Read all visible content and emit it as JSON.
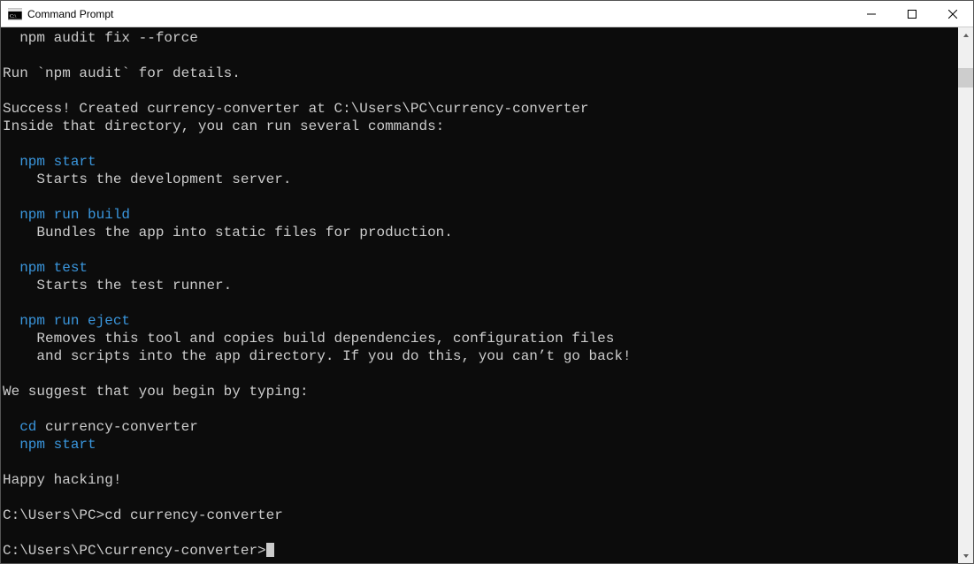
{
  "window": {
    "title": "Command Prompt"
  },
  "terminal": {
    "lines": [
      {
        "indent": 2,
        "segments": [
          {
            "style": "white",
            "text": "npm audit fix --force"
          }
        ]
      },
      {
        "blank": true
      },
      {
        "indent": 0,
        "segments": [
          {
            "style": "white",
            "text": "Run `npm audit` for details."
          }
        ]
      },
      {
        "blank": true
      },
      {
        "indent": 0,
        "segments": [
          {
            "style": "white",
            "text": "Success! Created currency-converter at C:\\Users\\PC\\currency-converter"
          }
        ]
      },
      {
        "indent": 0,
        "segments": [
          {
            "style": "white",
            "text": "Inside that directory, you can run several commands:"
          }
        ]
      },
      {
        "blank": true
      },
      {
        "indent": 2,
        "segments": [
          {
            "style": "cyan",
            "text": "npm start"
          }
        ]
      },
      {
        "indent": 4,
        "segments": [
          {
            "style": "white",
            "text": "Starts the development server."
          }
        ]
      },
      {
        "blank": true
      },
      {
        "indent": 2,
        "segments": [
          {
            "style": "cyan",
            "text": "npm run build"
          }
        ]
      },
      {
        "indent": 4,
        "segments": [
          {
            "style": "white",
            "text": "Bundles the app into static files for production."
          }
        ]
      },
      {
        "blank": true
      },
      {
        "indent": 2,
        "segments": [
          {
            "style": "cyan",
            "text": "npm test"
          }
        ]
      },
      {
        "indent": 4,
        "segments": [
          {
            "style": "white",
            "text": "Starts the test runner."
          }
        ]
      },
      {
        "blank": true
      },
      {
        "indent": 2,
        "segments": [
          {
            "style": "cyan",
            "text": "npm run eject"
          }
        ]
      },
      {
        "indent": 4,
        "segments": [
          {
            "style": "white",
            "text": "Removes this tool and copies build dependencies, configuration files"
          }
        ]
      },
      {
        "indent": 4,
        "segments": [
          {
            "style": "white",
            "text": "and scripts into the app directory. If you do this, you can’t go back!"
          }
        ]
      },
      {
        "blank": true
      },
      {
        "indent": 0,
        "segments": [
          {
            "style": "white",
            "text": "We suggest that you begin by typing:"
          }
        ]
      },
      {
        "blank": true
      },
      {
        "indent": 2,
        "segments": [
          {
            "style": "cyan",
            "text": "cd "
          },
          {
            "style": "white",
            "text": "currency-converter"
          }
        ]
      },
      {
        "indent": 2,
        "segments": [
          {
            "style": "cyan",
            "text": "npm start"
          }
        ]
      },
      {
        "blank": true
      },
      {
        "indent": 0,
        "segments": [
          {
            "style": "white",
            "text": "Happy hacking!"
          }
        ]
      },
      {
        "blank": true
      },
      {
        "indent": 0,
        "segments": [
          {
            "style": "white",
            "text": "C:\\Users\\PC>cd currency-converter"
          }
        ]
      },
      {
        "blank": true
      },
      {
        "indent": 0,
        "segments": [
          {
            "style": "white",
            "text": "C:\\Users\\PC\\currency-converter>"
          }
        ],
        "cursor": true
      }
    ]
  },
  "scrollbar": {
    "thumb_top_pct": 5,
    "thumb_height_pct": 4
  }
}
